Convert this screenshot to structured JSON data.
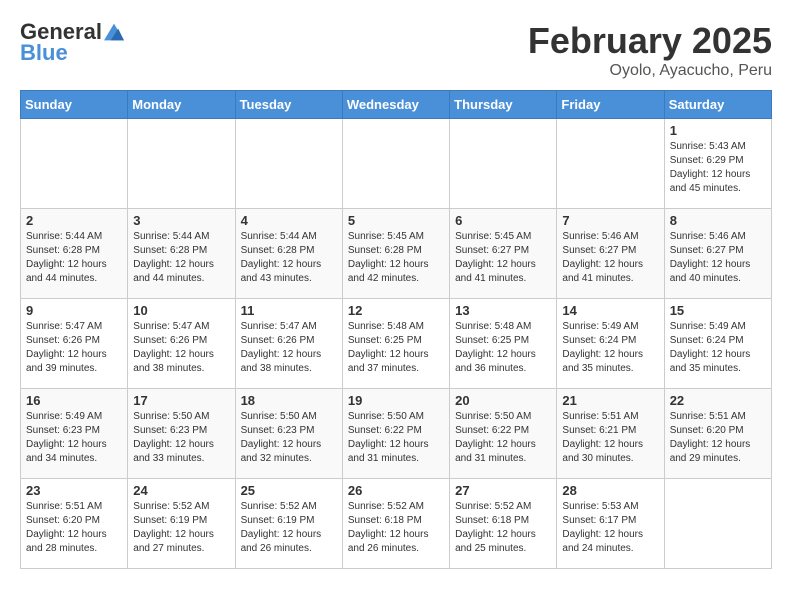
{
  "header": {
    "logo_line1": "General",
    "logo_line2": "Blue",
    "title": "February 2025",
    "subtitle": "Oyolo, Ayacucho, Peru"
  },
  "days_of_week": [
    "Sunday",
    "Monday",
    "Tuesday",
    "Wednesday",
    "Thursday",
    "Friday",
    "Saturday"
  ],
  "weeks": [
    [
      {
        "day": "",
        "info": ""
      },
      {
        "day": "",
        "info": ""
      },
      {
        "day": "",
        "info": ""
      },
      {
        "day": "",
        "info": ""
      },
      {
        "day": "",
        "info": ""
      },
      {
        "day": "",
        "info": ""
      },
      {
        "day": "1",
        "info": "Sunrise: 5:43 AM\nSunset: 6:29 PM\nDaylight: 12 hours\nand 45 minutes."
      }
    ],
    [
      {
        "day": "2",
        "info": "Sunrise: 5:44 AM\nSunset: 6:28 PM\nDaylight: 12 hours\nand 44 minutes."
      },
      {
        "day": "3",
        "info": "Sunrise: 5:44 AM\nSunset: 6:28 PM\nDaylight: 12 hours\nand 44 minutes."
      },
      {
        "day": "4",
        "info": "Sunrise: 5:44 AM\nSunset: 6:28 PM\nDaylight: 12 hours\nand 43 minutes."
      },
      {
        "day": "5",
        "info": "Sunrise: 5:45 AM\nSunset: 6:28 PM\nDaylight: 12 hours\nand 42 minutes."
      },
      {
        "day": "6",
        "info": "Sunrise: 5:45 AM\nSunset: 6:27 PM\nDaylight: 12 hours\nand 41 minutes."
      },
      {
        "day": "7",
        "info": "Sunrise: 5:46 AM\nSunset: 6:27 PM\nDaylight: 12 hours\nand 41 minutes."
      },
      {
        "day": "8",
        "info": "Sunrise: 5:46 AM\nSunset: 6:27 PM\nDaylight: 12 hours\nand 40 minutes."
      }
    ],
    [
      {
        "day": "9",
        "info": "Sunrise: 5:47 AM\nSunset: 6:26 PM\nDaylight: 12 hours\nand 39 minutes."
      },
      {
        "day": "10",
        "info": "Sunrise: 5:47 AM\nSunset: 6:26 PM\nDaylight: 12 hours\nand 38 minutes."
      },
      {
        "day": "11",
        "info": "Sunrise: 5:47 AM\nSunset: 6:26 PM\nDaylight: 12 hours\nand 38 minutes."
      },
      {
        "day": "12",
        "info": "Sunrise: 5:48 AM\nSunset: 6:25 PM\nDaylight: 12 hours\nand 37 minutes."
      },
      {
        "day": "13",
        "info": "Sunrise: 5:48 AM\nSunset: 6:25 PM\nDaylight: 12 hours\nand 36 minutes."
      },
      {
        "day": "14",
        "info": "Sunrise: 5:49 AM\nSunset: 6:24 PM\nDaylight: 12 hours\nand 35 minutes."
      },
      {
        "day": "15",
        "info": "Sunrise: 5:49 AM\nSunset: 6:24 PM\nDaylight: 12 hours\nand 35 minutes."
      }
    ],
    [
      {
        "day": "16",
        "info": "Sunrise: 5:49 AM\nSunset: 6:23 PM\nDaylight: 12 hours\nand 34 minutes."
      },
      {
        "day": "17",
        "info": "Sunrise: 5:50 AM\nSunset: 6:23 PM\nDaylight: 12 hours\nand 33 minutes."
      },
      {
        "day": "18",
        "info": "Sunrise: 5:50 AM\nSunset: 6:23 PM\nDaylight: 12 hours\nand 32 minutes."
      },
      {
        "day": "19",
        "info": "Sunrise: 5:50 AM\nSunset: 6:22 PM\nDaylight: 12 hours\nand 31 minutes."
      },
      {
        "day": "20",
        "info": "Sunrise: 5:50 AM\nSunset: 6:22 PM\nDaylight: 12 hours\nand 31 minutes."
      },
      {
        "day": "21",
        "info": "Sunrise: 5:51 AM\nSunset: 6:21 PM\nDaylight: 12 hours\nand 30 minutes."
      },
      {
        "day": "22",
        "info": "Sunrise: 5:51 AM\nSunset: 6:20 PM\nDaylight: 12 hours\nand 29 minutes."
      }
    ],
    [
      {
        "day": "23",
        "info": "Sunrise: 5:51 AM\nSunset: 6:20 PM\nDaylight: 12 hours\nand 28 minutes."
      },
      {
        "day": "24",
        "info": "Sunrise: 5:52 AM\nSunset: 6:19 PM\nDaylight: 12 hours\nand 27 minutes."
      },
      {
        "day": "25",
        "info": "Sunrise: 5:52 AM\nSunset: 6:19 PM\nDaylight: 12 hours\nand 26 minutes."
      },
      {
        "day": "26",
        "info": "Sunrise: 5:52 AM\nSunset: 6:18 PM\nDaylight: 12 hours\nand 26 minutes."
      },
      {
        "day": "27",
        "info": "Sunrise: 5:52 AM\nSunset: 6:18 PM\nDaylight: 12 hours\nand 25 minutes."
      },
      {
        "day": "28",
        "info": "Sunrise: 5:53 AM\nSunset: 6:17 PM\nDaylight: 12 hours\nand 24 minutes."
      },
      {
        "day": "",
        "info": ""
      }
    ]
  ]
}
